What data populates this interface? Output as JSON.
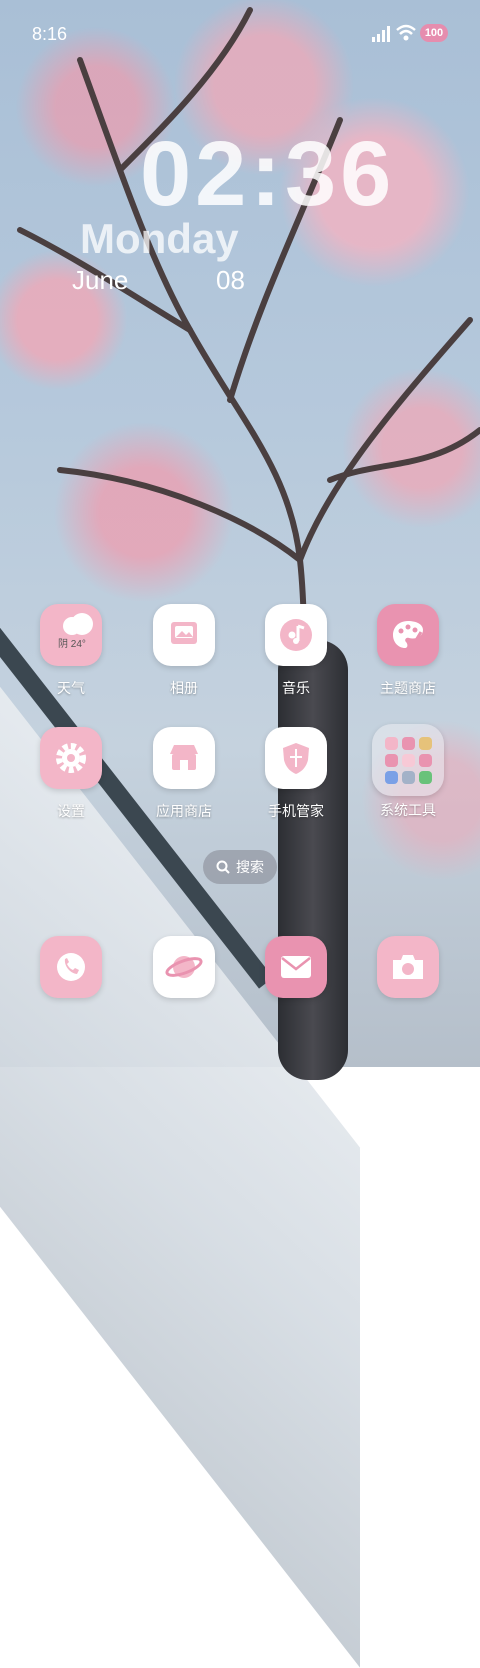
{
  "status_bar": {
    "time": "8:16",
    "battery": "100"
  },
  "clock": {
    "time": "02:36",
    "weekday": "Monday",
    "month": "June",
    "day": "08"
  },
  "apps": [
    {
      "label": "天气",
      "icon": "weather-icon",
      "weather_text": "阴 24°"
    },
    {
      "label": "相册",
      "icon": "gallery-icon"
    },
    {
      "label": "音乐",
      "icon": "music-icon"
    },
    {
      "label": "主题商店",
      "icon": "theme-store-icon"
    },
    {
      "label": "设置",
      "icon": "settings-icon"
    },
    {
      "label": "应用商店",
      "icon": "app-store-icon"
    },
    {
      "label": "手机管家",
      "icon": "phone-manager-icon"
    },
    {
      "label": "系统工具",
      "icon": "system-tools-folder-icon"
    }
  ],
  "search": {
    "label": "搜索"
  },
  "dock": [
    {
      "icon": "phone-icon"
    },
    {
      "icon": "browser-icon"
    },
    {
      "icon": "messages-icon"
    },
    {
      "icon": "camera-icon"
    }
  ],
  "colors": {
    "accent": "#f3b6c8",
    "accent_dark": "#e993b0"
  }
}
